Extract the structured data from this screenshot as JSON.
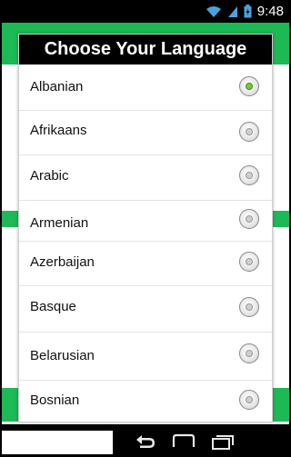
{
  "statusbar": {
    "time": "9:48",
    "icons": [
      "wifi-icon",
      "signal-icon",
      "battery-icon"
    ]
  },
  "dialog": {
    "title": "Choose Your Language",
    "items": [
      {
        "label": "Albanian",
        "selected": true
      },
      {
        "label": "Afrikaans",
        "selected": false
      },
      {
        "label": "Arabic",
        "selected": false
      },
      {
        "label": "Armenian",
        "selected": false
      },
      {
        "label": "Azerbaijan",
        "selected": false
      },
      {
        "label": "Basque",
        "selected": false
      },
      {
        "label": "Belarusian",
        "selected": false
      },
      {
        "label": "Bosnian",
        "selected": false
      }
    ]
  },
  "navbar": {
    "icons": [
      "back-icon",
      "home-icon",
      "recent-apps-icon"
    ]
  },
  "colors": {
    "accent_green": "#1db954",
    "title_bar": "#000000",
    "selected_radio": "#6fcf3a"
  }
}
